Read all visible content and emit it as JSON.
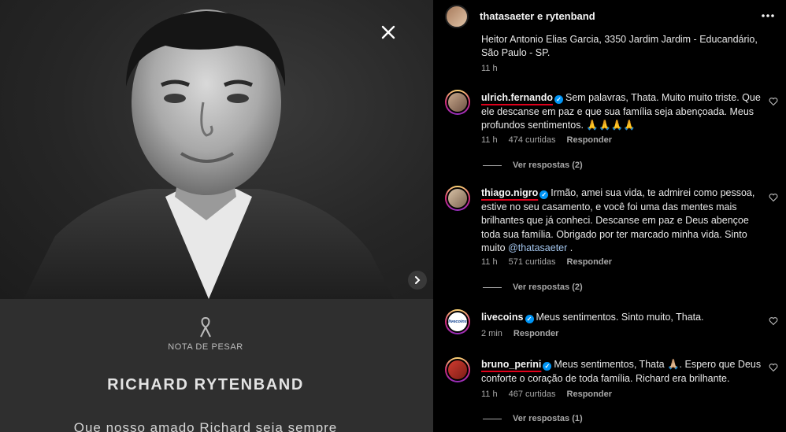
{
  "post": {
    "header_title": "thatasaeter e rytenband",
    "caption_tail_line1": "Heitor Antonio Elias Garcia, 3350 Jardim Jardim - Educandário,",
    "caption_tail_line2": "São Paulo - SP.",
    "caption_time": "11 h"
  },
  "image": {
    "notice_title": "NOTA DE PESAR",
    "name": "RICHARD RYTENBAND",
    "message": "Que nosso amado Richard seja sempre"
  },
  "comments": [
    {
      "username": "ulrich.fernando",
      "text": "Sem palavras, Thata. Muito muito triste. Que ele descanse em paz e que sua família seja abençoada. Meus profundos sentimentos. 🙏🙏🙏🙏",
      "time": "11 h",
      "likes": "474 curtidas",
      "reply": "Responder",
      "view_replies": "Ver respostas (2)"
    },
    {
      "username": "thiago.nigro",
      "text": "Irmão, amei sua vida, te admirei como pessoa, estive no seu casamento, e você foi uma das mentes mais brilhantes que já conheci. Descanse em paz e Deus abençoe toda sua família. Obrigado por ter marcado minha vida. Sinto muito",
      "mention": "@thatasaeter",
      "suffix": " .",
      "time": "11 h",
      "likes": "571 curtidas",
      "reply": "Responder",
      "view_replies": "Ver respostas (2)"
    },
    {
      "username": "livecoins",
      "text": "Meus sentimentos. Sinto muito, Thata.",
      "avatar_label": "livecoins",
      "time": "2 min",
      "reply": "Responder"
    },
    {
      "username": "bruno_perini",
      "text": "Meus sentimentos, Thata 🙏🏼. Espero que Deus conforte o coração de toda família. Richard era brilhante.",
      "time": "11 h",
      "likes": "467 curtidas",
      "reply": "Responder",
      "view_replies": "Ver respostas (1)"
    }
  ],
  "colors": {
    "accent_blue": "#0095f6",
    "underline_red": "#e0001b",
    "panel_bg": "#000000"
  },
  "icons": [
    "close-icon",
    "chevron-right-icon",
    "more-icon",
    "heart-icon",
    "verified-icon",
    "ribbon-icon"
  ]
}
